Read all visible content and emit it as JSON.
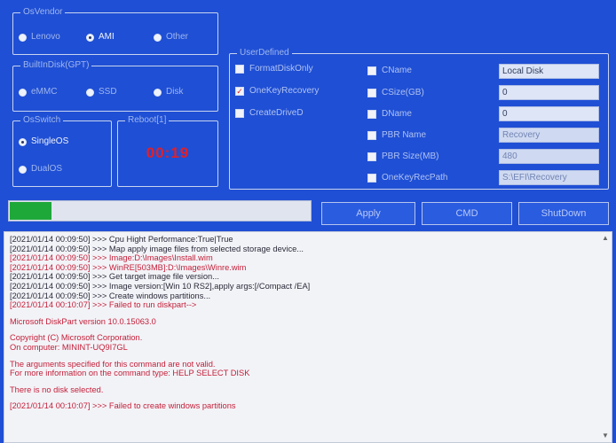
{
  "osvendor": {
    "title": "OsVendor",
    "options": [
      {
        "label": "Lenovo",
        "selected": false
      },
      {
        "label": "AMI",
        "selected": true
      },
      {
        "label": "Other",
        "selected": false
      }
    ]
  },
  "builtin_disk": {
    "title": "BuiltInDisk(GPT)",
    "options": [
      {
        "label": "eMMC",
        "selected": false
      },
      {
        "label": "SSD",
        "selected": false
      },
      {
        "label": "Disk",
        "selected": false
      }
    ]
  },
  "osswitch": {
    "title": "OsSwitch",
    "options": [
      {
        "label": "SingleOS",
        "selected": true
      },
      {
        "label": "DualOS",
        "selected": false
      }
    ]
  },
  "reboot": {
    "title": "Reboot[1]",
    "timer": "00:19",
    "timer_color": "#e0202a"
  },
  "user_defined": {
    "title": "UserDefined",
    "checks": [
      {
        "label": "FormatDiskOnly",
        "checked": false
      },
      {
        "label": "OneKeyRecovery",
        "checked": true
      },
      {
        "label": "CreateDriveD",
        "checked": false
      }
    ],
    "fields": [
      {
        "label": "CName",
        "value": "Local Disk",
        "enabled": true
      },
      {
        "label": "CSize(GB)",
        "value": "0",
        "enabled": true
      },
      {
        "label": "DName",
        "value": "0",
        "enabled": true
      },
      {
        "label": "PBR Name",
        "value": "Recovery",
        "enabled": false
      },
      {
        "label": "PBR Size(MB)",
        "value": "480",
        "enabled": false
      },
      {
        "label": "OneKeyRecPath",
        "value": "S:\\EFI\\Recovery",
        "enabled": false
      }
    ]
  },
  "progress": {
    "value": 0.14,
    "fill_color": "#1fa83a"
  },
  "buttons": {
    "apply": "Apply",
    "cmd": "CMD",
    "shutdown": "ShutDown"
  },
  "log": [
    {
      "text": "[2021/01/14 00:09:50] >>> Cpu Hight Performance:True|True",
      "color": "black"
    },
    {
      "text": "[2021/01/14 00:09:50] >>> Map apply image files from selected storage device...",
      "color": "black"
    },
    {
      "text": "[2021/01/14 00:09:50] >>> Image:D:\\Images\\Install.wim",
      "color": "red"
    },
    {
      "text": "[2021/01/14 00:09:50] >>> WinRE[503MB]:D:\\Images\\Winre.wim",
      "color": "red"
    },
    {
      "text": "[2021/01/14 00:09:50] >>> Get target image file version...",
      "color": "black"
    },
    {
      "text": "[2021/01/14 00:09:50] >>> Image version:[Win 10 RS2],apply args:[/Compact /EA]",
      "color": "black"
    },
    {
      "text": "[2021/01/14 00:09:50] >>> Create windows partitions...",
      "color": "black"
    },
    {
      "text": "[2021/01/14 00:10:07] >>> Failed to run diskpart-->",
      "color": "red"
    },
    {
      "text": "",
      "color": "gap"
    },
    {
      "text": "Microsoft DiskPart version 10.0.15063.0",
      "color": "red"
    },
    {
      "text": "",
      "color": "gap"
    },
    {
      "text": "Copyright (C) Microsoft Corporation.",
      "color": "red"
    },
    {
      "text": "On computer: MININT-UQ9I7GL",
      "color": "red"
    },
    {
      "text": "",
      "color": "gap"
    },
    {
      "text": "The arguments specified for this command are not valid.",
      "color": "red"
    },
    {
      "text": "For more information on the command type: HELP SELECT DISK",
      "color": "red"
    },
    {
      "text": "",
      "color": "gap"
    },
    {
      "text": "There is no disk selected.",
      "color": "red"
    },
    {
      "text": "",
      "color": "gap"
    },
    {
      "text": "[2021/01/14 00:10:07] >>> Failed to create windows partitions",
      "color": "red"
    }
  ]
}
